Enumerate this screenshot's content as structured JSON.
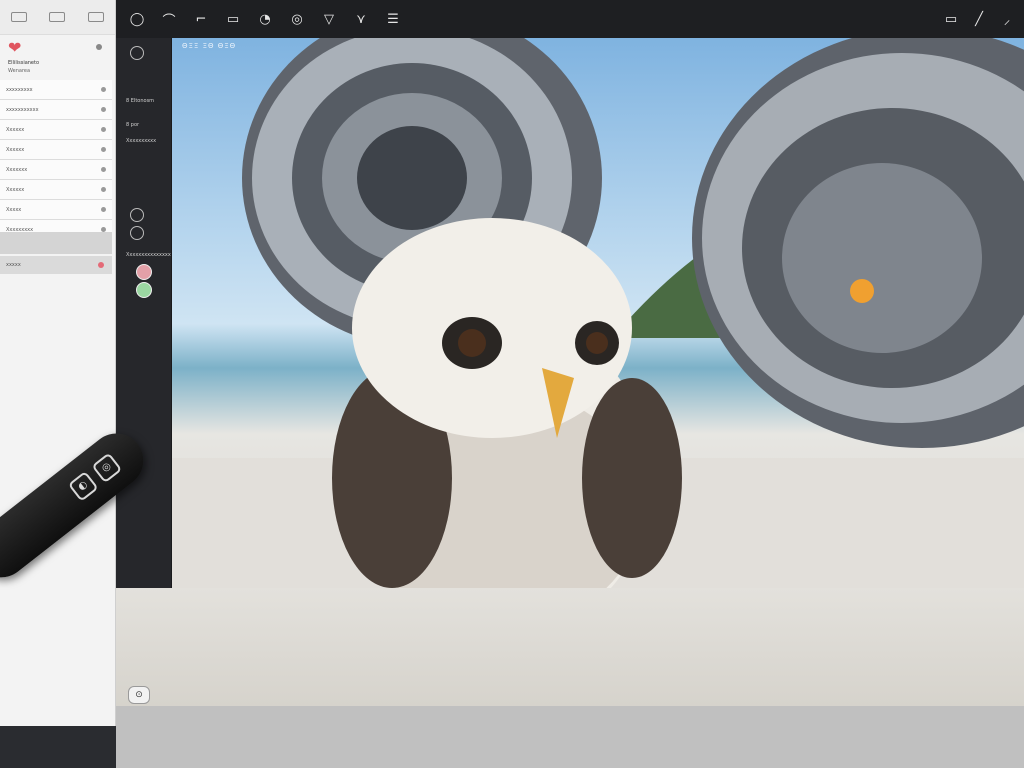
{
  "left_panel": {
    "name": "Ellilissianeto",
    "sub": "Wenarea",
    "rows": [
      "xxxxxxxxx",
      "xxxxxxxxxxx",
      "Xxxxxx",
      "Xxxxxx",
      "Xxxxxxx",
      "Xxxxxx",
      "Xxxxx",
      "Xxxxxxxxx"
    ],
    "grey_label": "xxxxx"
  },
  "toolbar": {
    "tools": [
      "◯",
      "⌒",
      "⌐",
      "▭",
      "◔",
      "◎",
      "▽",
      "⋎",
      "☰"
    ],
    "right_tools": [
      "▭",
      "╱",
      "⸝"
    ]
  },
  "sidebar": {
    "items": [
      "8 Eltonosm",
      "8 por",
      "Xxxxxxxxxx",
      "Xxxxxxxxxxxxxxx"
    ]
  },
  "canvas": {
    "title": "ΘΞΞ ΞΘ ΘΞΘ"
  }
}
